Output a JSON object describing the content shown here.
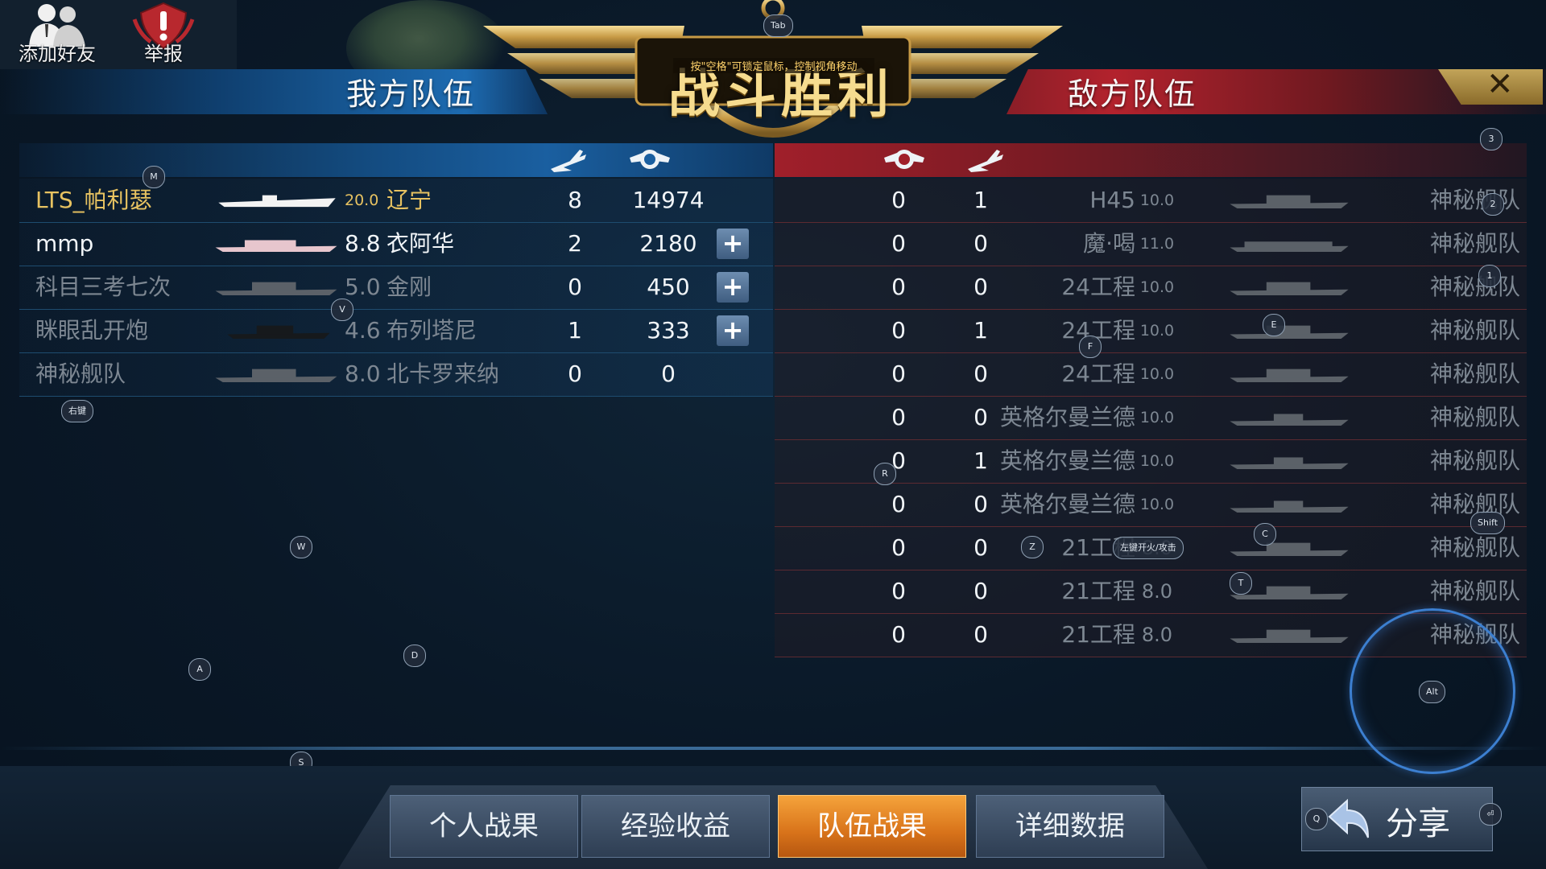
{
  "top_buttons": {
    "add_friend": "添加好友",
    "report": "举报"
  },
  "banner": {
    "victory_title": "战斗胜利",
    "hint": "按\"空格\"可锁定鼠标，控制视角移动",
    "tab_key": "Tab"
  },
  "ally": {
    "title": "我方队伍",
    "rows": [
      {
        "player": "LTS_帕利瑟",
        "rating": "20.0",
        "ship": "辽宁",
        "kills": "8",
        "score": "14974",
        "has_plus": false,
        "style": "gold"
      },
      {
        "player": "mmp",
        "rating": "8.8",
        "ship": "衣阿华",
        "kills": "2",
        "score": "2180",
        "has_plus": true,
        "style": "bright"
      },
      {
        "player": "科目三考七次",
        "rating": "5.0",
        "ship": "金刚",
        "kills": "0",
        "score": "450",
        "has_plus": true,
        "style": "dim"
      },
      {
        "player": "眯眼乱开炮",
        "rating": "4.6",
        "ship": "布列塔尼",
        "kills": "1",
        "score": "333",
        "has_plus": true,
        "style": "dim"
      },
      {
        "player": "神秘舰队",
        "rating": "8.0",
        "ship": "北卡罗来纳",
        "kills": "0",
        "score": "0",
        "has_plus": false,
        "style": "dim"
      }
    ],
    "plus_label": "+"
  },
  "enemy": {
    "title": "敌方队伍",
    "rows": [
      {
        "score": "0",
        "kills": "1",
        "ship": "H45",
        "rating": "10.0",
        "player": "神秘舰队"
      },
      {
        "score": "0",
        "kills": "0",
        "ship": "魔·喝",
        "rating": "11.0",
        "player": "神秘舰队"
      },
      {
        "score": "0",
        "kills": "0",
        "ship": "24工程",
        "rating": "10.0",
        "player": "神秘舰队"
      },
      {
        "score": "0",
        "kills": "1",
        "ship": "24工程",
        "rating": "10.0",
        "player": "神秘舰队"
      },
      {
        "score": "0",
        "kills": "0",
        "ship": "24工程",
        "rating": "10.0",
        "player": "神秘舰队"
      },
      {
        "score": "0",
        "kills": "0",
        "ship": "英格尔曼兰德",
        "rating": "10.0",
        "player": "神秘舰队"
      },
      {
        "score": "0",
        "kills": "1",
        "ship": "英格尔曼兰德",
        "rating": "10.0",
        "player": "神秘舰队"
      },
      {
        "score": "0",
        "kills": "0",
        "ship": "英格尔曼兰德",
        "rating": "10.0",
        "player": "神秘舰队"
      },
      {
        "score": "0",
        "kills": "0",
        "ship": "21工程",
        "rating": "8.0",
        "player": "神秘舰队"
      },
      {
        "score": "0",
        "kills": "0",
        "ship": "21工程",
        "rating": "8.0",
        "player": "神秘舰队"
      },
      {
        "score": "0",
        "kills": "0",
        "ship": "21工程",
        "rating": "8.0",
        "player": "神秘舰队"
      }
    ]
  },
  "key_hints": {
    "M": "M",
    "V": "V",
    "right_click": "右键",
    "W": "W",
    "A": "A",
    "D": "D",
    "S": "S",
    "R": "R",
    "F": "F",
    "E": "E",
    "Z": "Z",
    "left_click_fire": "左键开火/攻击",
    "C": "C",
    "T": "T",
    "k3": "3",
    "k2": "2",
    "k1": "1",
    "shift": "Shift",
    "alt": "Alt",
    "Q": "Q",
    "enter": "⏎"
  },
  "tabs": [
    {
      "label": "个人战果",
      "active": false
    },
    {
      "label": "经验收益",
      "active": false
    },
    {
      "label": "队伍战果",
      "active": true
    },
    {
      "label": "详细数据",
      "active": false
    }
  ],
  "share": {
    "label": "分享"
  },
  "close_label": "✕",
  "colors": {
    "ally_accent": "#1d6bb1",
    "enemy_accent": "#b3222d",
    "gold": "#e7c261",
    "active_tab": "#e8892a"
  }
}
